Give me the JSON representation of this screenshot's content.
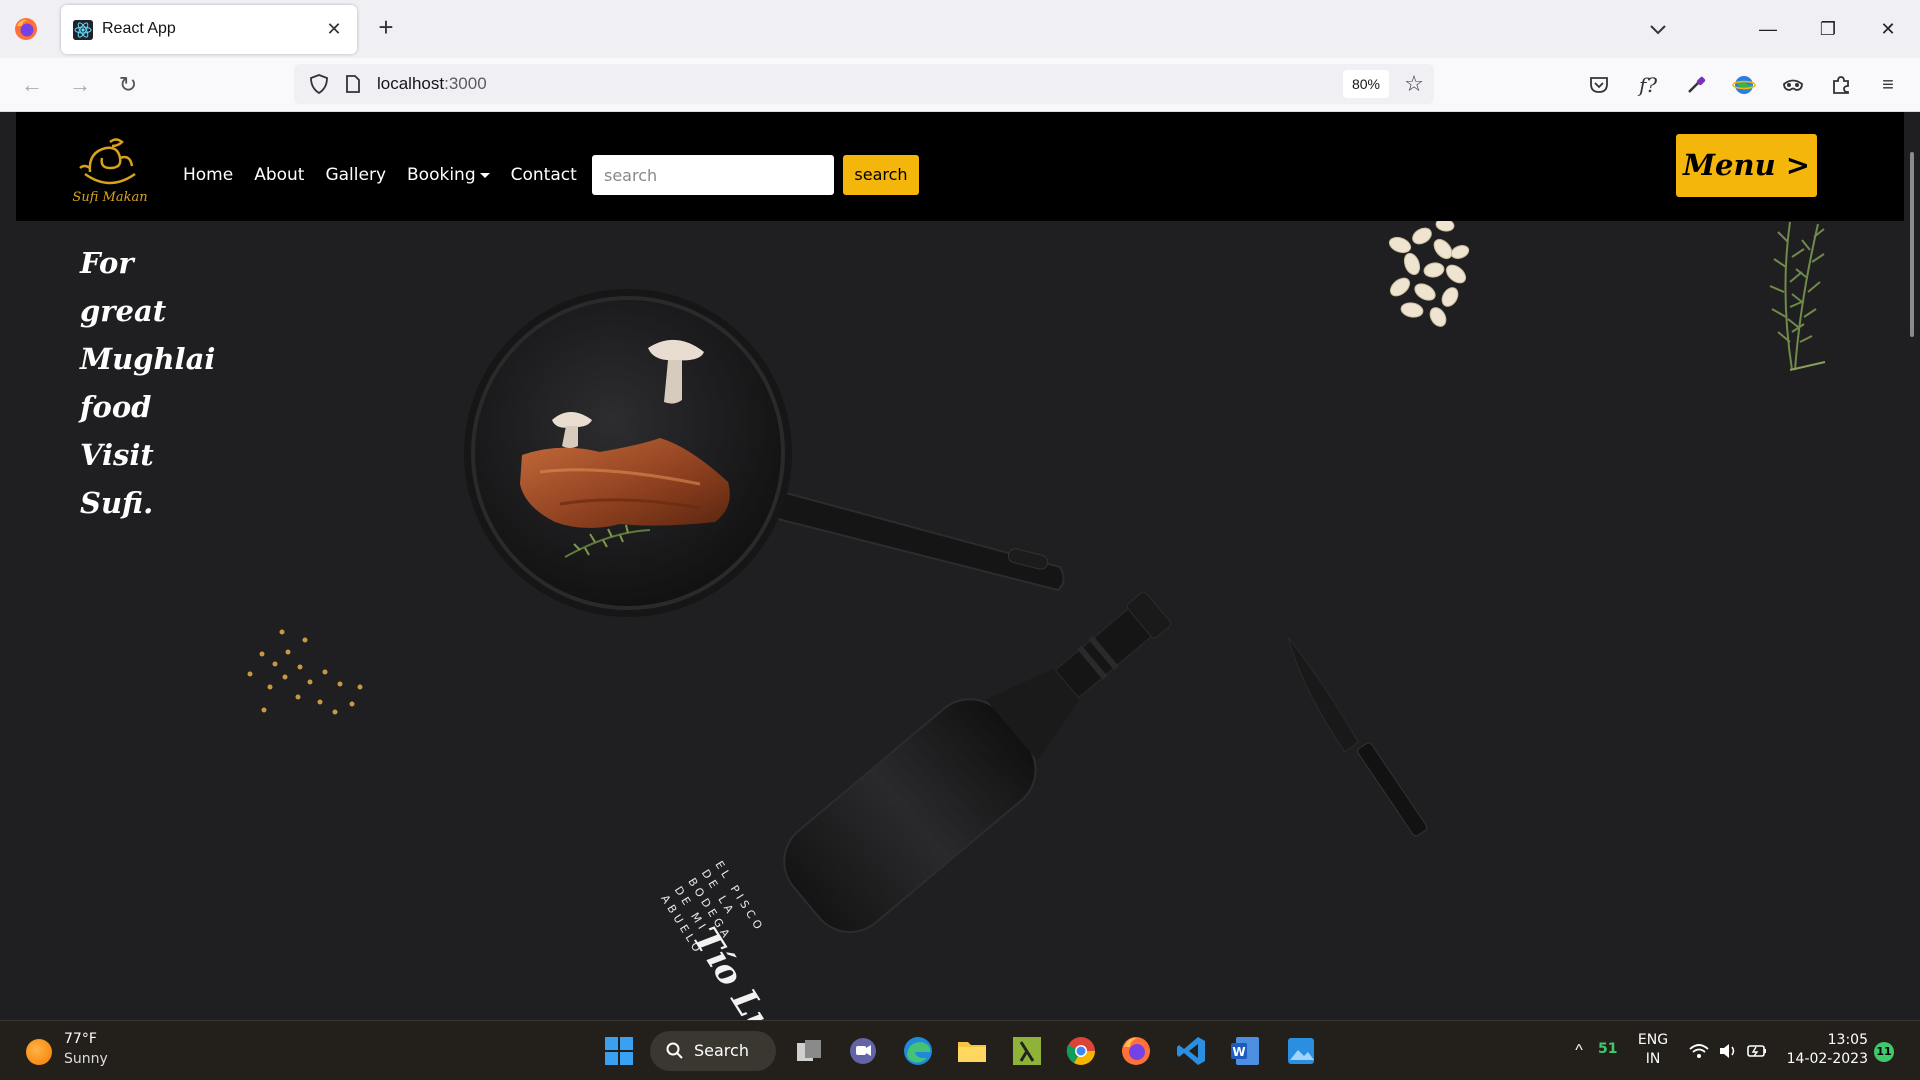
{
  "browser": {
    "tab_title": "React App",
    "url_host": "localhost",
    "url_port": ":3000",
    "zoom": "80%"
  },
  "site": {
    "brand": "Sufi Makan",
    "nav": {
      "home": "Home",
      "about": "About",
      "gallery": "Gallery",
      "booking": "Booking",
      "contact": "Contact"
    },
    "search_placeholder": "search",
    "search_button": "search",
    "menu_button": "Menu >",
    "hero_lines": [
      "For",
      "great",
      "Mughlai",
      "food",
      "Visit",
      "Sufi."
    ],
    "bottle_lines": [
      "EL PISCO",
      "DE LA",
      "BODEGA",
      "DE MI",
      "ABUELO"
    ],
    "bottle_brand": "Tío Luchín"
  },
  "taskbar": {
    "weather_temp": "77°F",
    "weather_desc": "Sunny",
    "search_label": "Search",
    "tray_count": "51",
    "lang_1": "ENG",
    "lang_2": "IN",
    "time": "13:05",
    "date": "14-02-2023",
    "notification_count": "11"
  },
  "colors": {
    "accent": "#f5b60b",
    "page_bg": "#1f1f21",
    "nav_bg": "#000000"
  }
}
